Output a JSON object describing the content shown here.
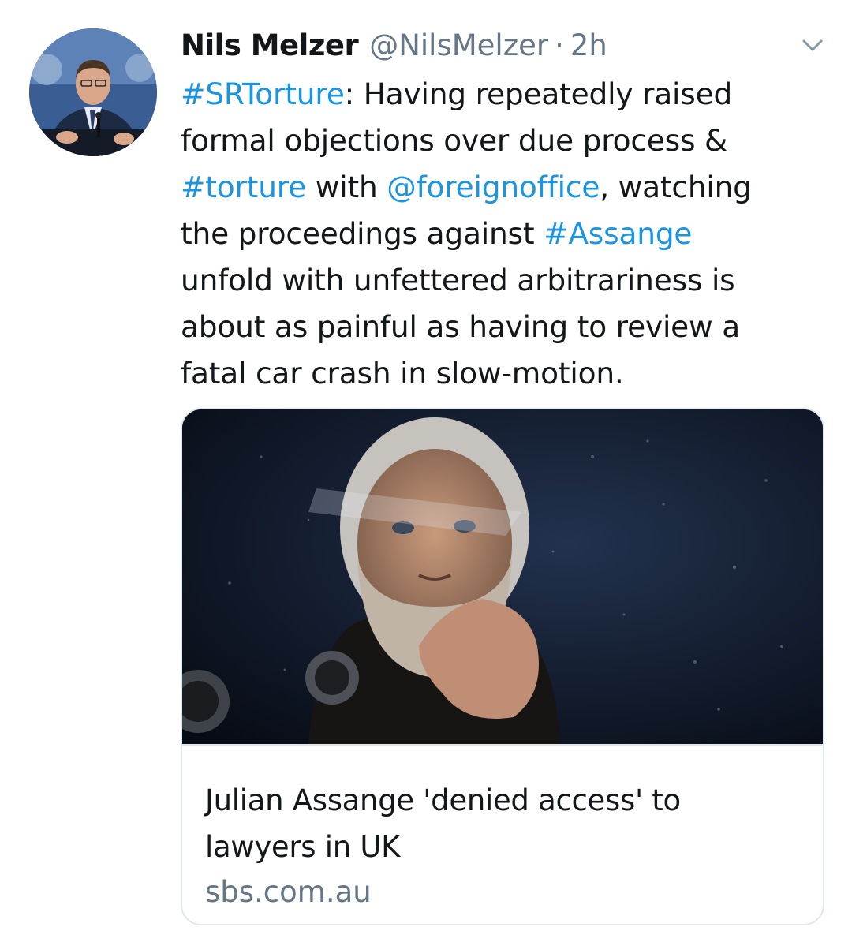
{
  "tweet": {
    "author": {
      "display_name": "Nils Melzer",
      "handle": "@NilsMelzer",
      "separator": "·",
      "time": "2h",
      "avatar_icon": "profile-photo"
    },
    "text_lines": [
      [
        {
          "text": "#SRTorture",
          "link": true
        },
        {
          "text": ": Having repeatedly raised",
          "link": false
        }
      ],
      [
        {
          "text": "formal objections over due process &",
          "link": false
        }
      ],
      [
        {
          "text": "#torture",
          "link": true
        },
        {
          "text": " with ",
          "link": false
        },
        {
          "text": "@foreignoffice",
          "link": true
        },
        {
          "text": ", watching",
          "link": false
        }
      ],
      [
        {
          "text": "the proceedings against ",
          "link": false
        },
        {
          "text": "#Assange",
          "link": true
        }
      ],
      [
        {
          "text": "unfold with unfettered arbitrariness is",
          "link": false
        }
      ],
      [
        {
          "text": "about as painful as having to review a",
          "link": false
        }
      ],
      [
        {
          "text": "fatal car crash in slow-motion.",
          "link": false
        }
      ]
    ],
    "card": {
      "title_lines": [
        "Julian Assange 'denied access' to",
        "lawyers in UK"
      ],
      "domain": "sbs.com.au",
      "image_icon": "news-photo"
    },
    "menu_icon": "chevron-down-icon"
  },
  "colors": {
    "link": "#1b95e0",
    "text": "#14171a",
    "secondary": "#657786",
    "border": "#e1e8ed"
  }
}
